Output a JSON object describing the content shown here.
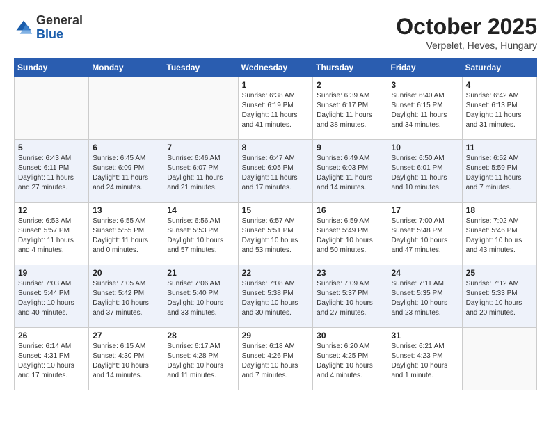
{
  "header": {
    "logo_general": "General",
    "logo_blue": "Blue",
    "month": "October 2025",
    "location": "Verpelet, Heves, Hungary"
  },
  "weekdays": [
    "Sunday",
    "Monday",
    "Tuesday",
    "Wednesday",
    "Thursday",
    "Friday",
    "Saturday"
  ],
  "weeks": [
    [
      {
        "day": "",
        "info": ""
      },
      {
        "day": "",
        "info": ""
      },
      {
        "day": "",
        "info": ""
      },
      {
        "day": "1",
        "info": "Sunrise: 6:38 AM\nSunset: 6:19 PM\nDaylight: 11 hours and 41 minutes."
      },
      {
        "day": "2",
        "info": "Sunrise: 6:39 AM\nSunset: 6:17 PM\nDaylight: 11 hours and 38 minutes."
      },
      {
        "day": "3",
        "info": "Sunrise: 6:40 AM\nSunset: 6:15 PM\nDaylight: 11 hours and 34 minutes."
      },
      {
        "day": "4",
        "info": "Sunrise: 6:42 AM\nSunset: 6:13 PM\nDaylight: 11 hours and 31 minutes."
      }
    ],
    [
      {
        "day": "5",
        "info": "Sunrise: 6:43 AM\nSunset: 6:11 PM\nDaylight: 11 hours and 27 minutes."
      },
      {
        "day": "6",
        "info": "Sunrise: 6:45 AM\nSunset: 6:09 PM\nDaylight: 11 hours and 24 minutes."
      },
      {
        "day": "7",
        "info": "Sunrise: 6:46 AM\nSunset: 6:07 PM\nDaylight: 11 hours and 21 minutes."
      },
      {
        "day": "8",
        "info": "Sunrise: 6:47 AM\nSunset: 6:05 PM\nDaylight: 11 hours and 17 minutes."
      },
      {
        "day": "9",
        "info": "Sunrise: 6:49 AM\nSunset: 6:03 PM\nDaylight: 11 hours and 14 minutes."
      },
      {
        "day": "10",
        "info": "Sunrise: 6:50 AM\nSunset: 6:01 PM\nDaylight: 11 hours and 10 minutes."
      },
      {
        "day": "11",
        "info": "Sunrise: 6:52 AM\nSunset: 5:59 PM\nDaylight: 11 hours and 7 minutes."
      }
    ],
    [
      {
        "day": "12",
        "info": "Sunrise: 6:53 AM\nSunset: 5:57 PM\nDaylight: 11 hours and 4 minutes."
      },
      {
        "day": "13",
        "info": "Sunrise: 6:55 AM\nSunset: 5:55 PM\nDaylight: 11 hours and 0 minutes."
      },
      {
        "day": "14",
        "info": "Sunrise: 6:56 AM\nSunset: 5:53 PM\nDaylight: 10 hours and 57 minutes."
      },
      {
        "day": "15",
        "info": "Sunrise: 6:57 AM\nSunset: 5:51 PM\nDaylight: 10 hours and 53 minutes."
      },
      {
        "day": "16",
        "info": "Sunrise: 6:59 AM\nSunset: 5:49 PM\nDaylight: 10 hours and 50 minutes."
      },
      {
        "day": "17",
        "info": "Sunrise: 7:00 AM\nSunset: 5:48 PM\nDaylight: 10 hours and 47 minutes."
      },
      {
        "day": "18",
        "info": "Sunrise: 7:02 AM\nSunset: 5:46 PM\nDaylight: 10 hours and 43 minutes."
      }
    ],
    [
      {
        "day": "19",
        "info": "Sunrise: 7:03 AM\nSunset: 5:44 PM\nDaylight: 10 hours and 40 minutes."
      },
      {
        "day": "20",
        "info": "Sunrise: 7:05 AM\nSunset: 5:42 PM\nDaylight: 10 hours and 37 minutes."
      },
      {
        "day": "21",
        "info": "Sunrise: 7:06 AM\nSunset: 5:40 PM\nDaylight: 10 hours and 33 minutes."
      },
      {
        "day": "22",
        "info": "Sunrise: 7:08 AM\nSunset: 5:38 PM\nDaylight: 10 hours and 30 minutes."
      },
      {
        "day": "23",
        "info": "Sunrise: 7:09 AM\nSunset: 5:37 PM\nDaylight: 10 hours and 27 minutes."
      },
      {
        "day": "24",
        "info": "Sunrise: 7:11 AM\nSunset: 5:35 PM\nDaylight: 10 hours and 23 minutes."
      },
      {
        "day": "25",
        "info": "Sunrise: 7:12 AM\nSunset: 5:33 PM\nDaylight: 10 hours and 20 minutes."
      }
    ],
    [
      {
        "day": "26",
        "info": "Sunrise: 6:14 AM\nSunset: 4:31 PM\nDaylight: 10 hours and 17 minutes."
      },
      {
        "day": "27",
        "info": "Sunrise: 6:15 AM\nSunset: 4:30 PM\nDaylight: 10 hours and 14 minutes."
      },
      {
        "day": "28",
        "info": "Sunrise: 6:17 AM\nSunset: 4:28 PM\nDaylight: 10 hours and 11 minutes."
      },
      {
        "day": "29",
        "info": "Sunrise: 6:18 AM\nSunset: 4:26 PM\nDaylight: 10 hours and 7 minutes."
      },
      {
        "day": "30",
        "info": "Sunrise: 6:20 AM\nSunset: 4:25 PM\nDaylight: 10 hours and 4 minutes."
      },
      {
        "day": "31",
        "info": "Sunrise: 6:21 AM\nSunset: 4:23 PM\nDaylight: 10 hours and 1 minute."
      },
      {
        "day": "",
        "info": ""
      }
    ]
  ]
}
